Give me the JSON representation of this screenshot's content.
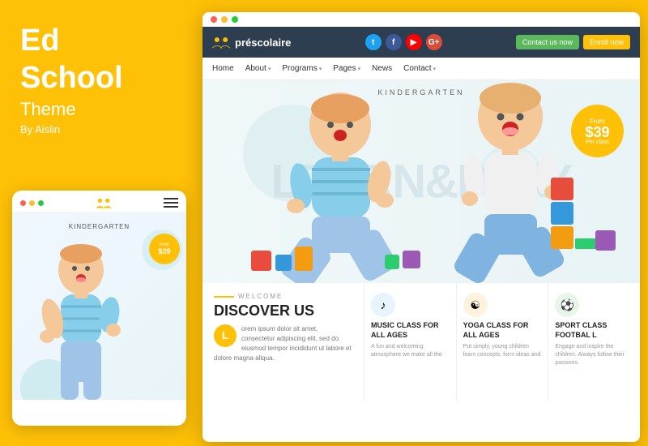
{
  "left": {
    "title_line1": "Ed",
    "title_line2": "School",
    "subtitle": "Theme",
    "by": "By Aislin"
  },
  "mobile": {
    "kindergarten_label": "KINDERGARTEN",
    "price_from": "From",
    "price": "$39"
  },
  "desktop": {
    "brand_name": "préscolaire",
    "top_bar_dots": [
      "red",
      "yellow",
      "green"
    ],
    "nav_items": [
      "Home",
      "About",
      "Programs",
      "Pages",
      "News",
      "Contact"
    ],
    "btn_contact": "Contact us now",
    "btn_enroll": "Enroll now",
    "hero": {
      "label": "KINDERGARTEN",
      "big_text": "LEARN&PLAY",
      "price_from": "From",
      "price": "$39",
      "price_per": "Per class"
    },
    "welcome": {
      "label": "WELCOME",
      "title": "DISCOVER US",
      "initial": "L",
      "text": "orem ipsum dolor sit amet, consectetur adipiscing elit, sed do eiusmod tempor incididunt ut labore et dolore magna aliqua."
    },
    "classes": [
      {
        "title": "MUSIC CLASS FOR ALL AGES",
        "icon": "♪",
        "icon_class": "icon-music",
        "desc": "A fun and welcoming atmosphere we make all the"
      },
      {
        "title": "YOGA CLASS FOR ALL AGES",
        "icon": "☯",
        "icon_class": "icon-yoga",
        "desc": "Put simply, young children learn concepts, form ideas and"
      },
      {
        "title": "SPORT CLASS FOOTBAL L",
        "icon": "⚽",
        "icon_class": "icon-sport",
        "desc": "Engage and inspire the children. Always follow their passions."
      }
    ]
  }
}
